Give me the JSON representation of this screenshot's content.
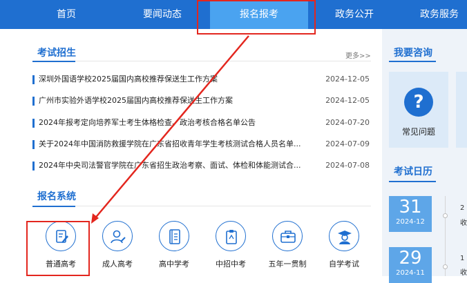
{
  "nav": {
    "items": [
      "首页",
      "要闻动态",
      "报名报考",
      "政务公开",
      "政务服务"
    ],
    "active": "报名报考"
  },
  "exam_recruit": {
    "title": "考试招生",
    "more": "更多>>",
    "news": [
      {
        "title": "深圳外国语学校2025届国内高校推荐保送生工作方案",
        "date": "2024-12-05"
      },
      {
        "title": "广州市实验外语学校2025届国内高校推荐保送生工作方案",
        "date": "2024-12-05"
      },
      {
        "title": "2024年报考定向培养军士考生体格检查、政治考核合格名单公告",
        "date": "2024-07-20"
      },
      {
        "title": "关于2024年中国消防救援学院在广东省招收青年学生考核测试合格人员名单...",
        "date": "2024-07-09"
      },
      {
        "title": "2024年中央司法警官学院在广东省招生政治考察、面试、体检和体能测试合...",
        "date": "2024-07-08"
      }
    ]
  },
  "registration_system": {
    "title": "报名系统",
    "items": [
      {
        "label": "普通高考",
        "icon": "pen-document-icon"
      },
      {
        "label": "成人高考",
        "icon": "person-edit-icon"
      },
      {
        "label": "高中学考",
        "icon": "notebook-icon"
      },
      {
        "label": "中招中考",
        "icon": "clipboard-icon"
      },
      {
        "label": "五年一贯制",
        "icon": "briefcase-icon"
      },
      {
        "label": "自学考试",
        "icon": "graduate-icon"
      }
    ]
  },
  "consult": {
    "title": "我要咨询",
    "card_label": "常见问题",
    "icon": "question-icon"
  },
  "calendar": {
    "title": "考试日历",
    "entries": [
      {
        "day": "31",
        "ym": "2024-12",
        "snip_top": "2",
        "snip_bottom": "收"
      },
      {
        "day": "29",
        "ym": "2024-11",
        "snip_top": "1",
        "snip_bottom": "收"
      }
    ]
  },
  "colors": {
    "primary": "#1f6fd0",
    "active_tab": "#4aa3f0",
    "highlight": "#e3261e",
    "calendar_date": "#5ea6e8"
  }
}
